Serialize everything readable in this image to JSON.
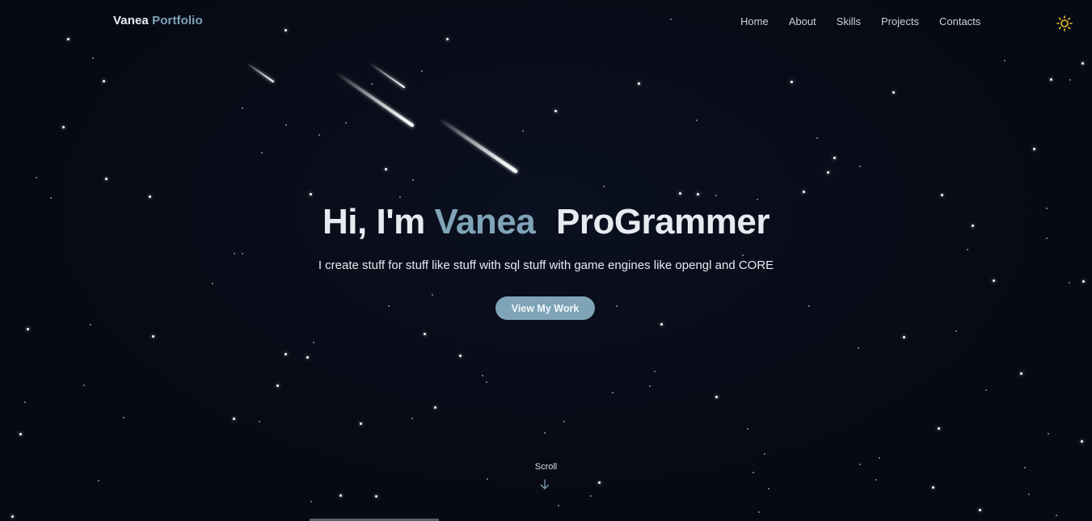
{
  "brand": {
    "first": "Vanea",
    "second": "Portfolio"
  },
  "nav": {
    "items": [
      "Home",
      "About",
      "Skills",
      "Projects",
      "Contacts"
    ],
    "theme_toggle_icon": "sun-icon"
  },
  "hero": {
    "greeting": "Hi, I'm",
    "name": "Vanea",
    "role": "ProGrammer",
    "subtitle": "I create stuff for stuff like stuff with sql stuff with game engines like opengl and CORE",
    "cta_label": "View My Work"
  },
  "scroll": {
    "label": "Scroll",
    "icon": "arrow-down-icon"
  },
  "colors": {
    "background": "#070a13",
    "accent": "#7fa4b8",
    "text": "#e6ebf2",
    "sun": "#f2c230"
  }
}
